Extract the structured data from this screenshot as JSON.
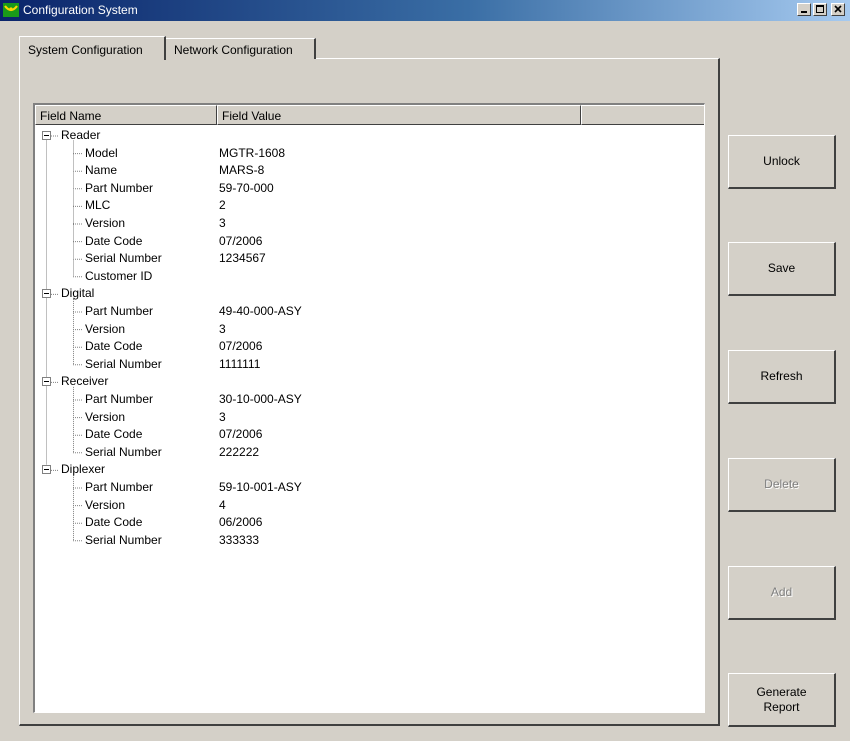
{
  "window": {
    "title": "Configuration System",
    "app_icon": "app-logo-icon",
    "controls": [
      "minimize-icon",
      "maximize-icon",
      "close-icon"
    ]
  },
  "tabs": [
    {
      "label": "System Configuration",
      "active": true
    },
    {
      "label": "Network Configuration",
      "active": false
    }
  ],
  "columns": [
    "Field Name",
    "Field Value",
    ""
  ],
  "tree": [
    {
      "name": "Reader",
      "children": [
        {
          "name": "Model",
          "value": "MGTR-1608"
        },
        {
          "name": "Name",
          "value": "MARS-8"
        },
        {
          "name": "Part Number",
          "value": "59-70-000"
        },
        {
          "name": "MLC",
          "value": "2"
        },
        {
          "name": "Version",
          "value": "3"
        },
        {
          "name": "Date Code",
          "value": "07/2006"
        },
        {
          "name": "Serial Number",
          "value": "1234567"
        },
        {
          "name": "Customer ID",
          "value": ""
        }
      ]
    },
    {
      "name": "Digital",
      "children": [
        {
          "name": "Part Number",
          "value": "49-40-000-ASY"
        },
        {
          "name": "Version",
          "value": "3"
        },
        {
          "name": "Date Code",
          "value": "07/2006"
        },
        {
          "name": "Serial Number",
          "value": "1111111"
        }
      ]
    },
    {
      "name": "Receiver",
      "children": [
        {
          "name": "Part Number",
          "value": "30-10-000-ASY"
        },
        {
          "name": "Version",
          "value": "3"
        },
        {
          "name": "Date Code",
          "value": "07/2006"
        },
        {
          "name": "Serial Number",
          "value": "222222"
        }
      ]
    },
    {
      "name": "Diplexer",
      "children": [
        {
          "name": "Part Number",
          "value": "59-10-001-ASY"
        },
        {
          "name": "Version",
          "value": "4"
        },
        {
          "name": "Date Code",
          "value": "06/2006"
        },
        {
          "name": "Serial Number",
          "value": "333333"
        }
      ]
    }
  ],
  "buttons": [
    {
      "label": "Unlock",
      "enabled": true
    },
    {
      "label": "Save",
      "enabled": true
    },
    {
      "label": "Refresh",
      "enabled": true
    },
    {
      "label": "Delete",
      "enabled": false
    },
    {
      "label": "Add",
      "enabled": false
    },
    {
      "label": "Generate Report",
      "enabled": true
    }
  ],
  "colors": {
    "titlebar_start": "#0a246a",
    "titlebar_end": "#a6caf0",
    "face": "#d4d0c8",
    "disabled_text": "#808080"
  }
}
